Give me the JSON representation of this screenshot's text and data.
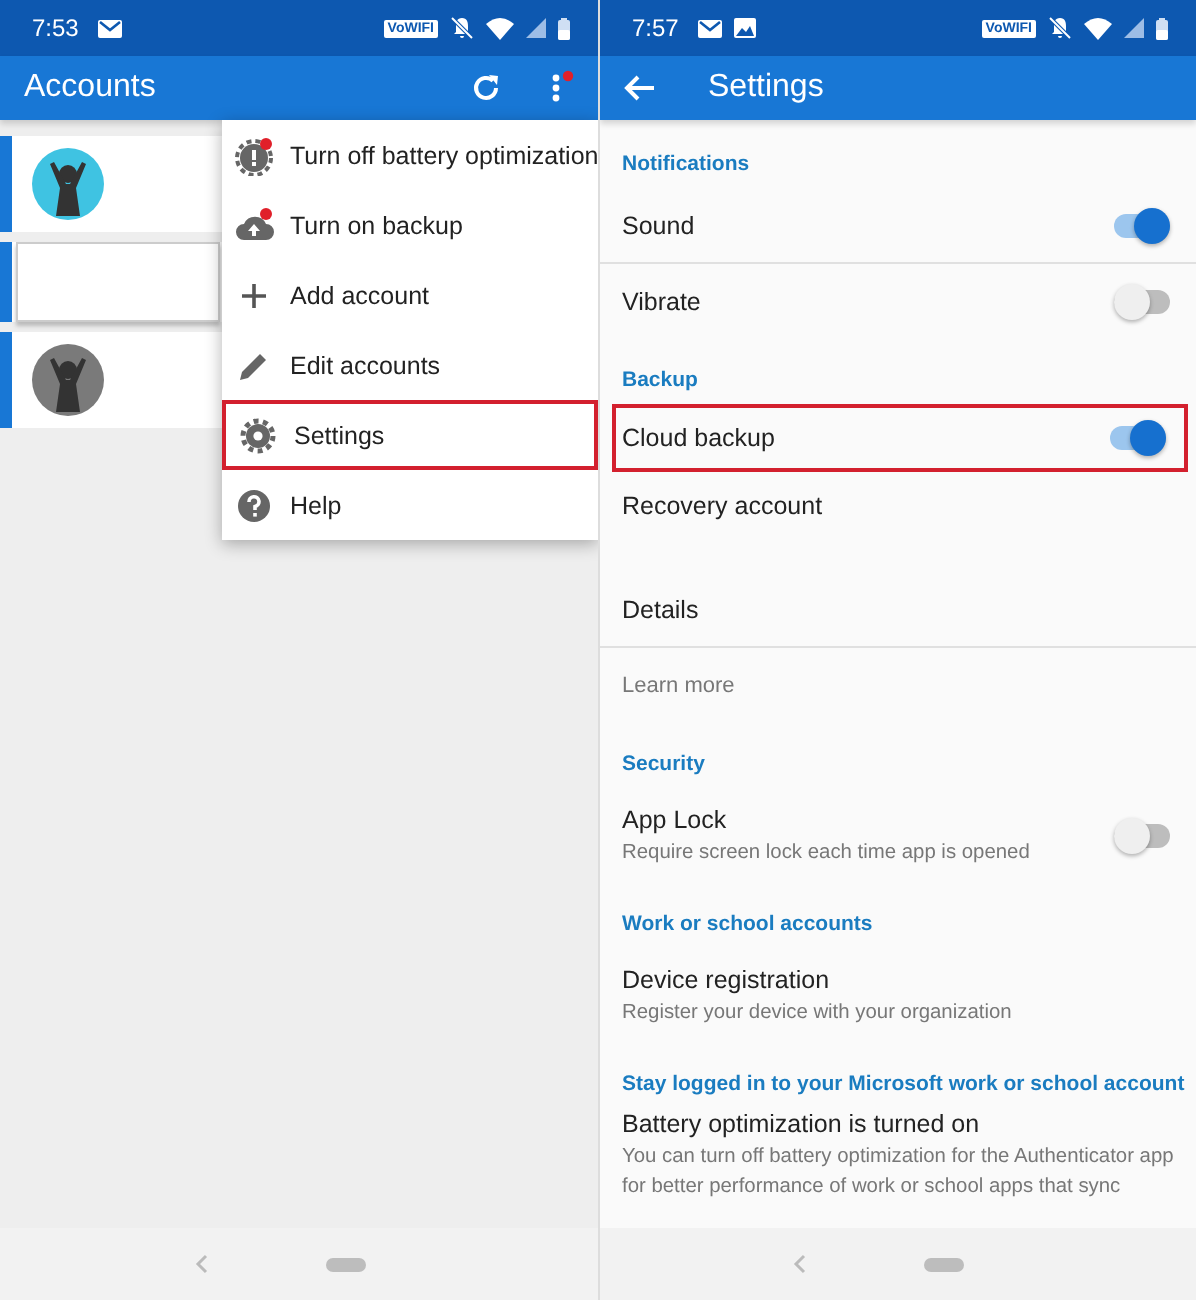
{
  "left_screen": {
    "status_bar": {
      "time": "7:53",
      "network_badge": "VoWIFI"
    },
    "app_bar": {
      "title": "Accounts",
      "more_badge": true
    },
    "accounts": [
      {
        "kind": "avatar",
        "color": "#3fc3e2"
      },
      {
        "kind": "blank"
      },
      {
        "kind": "avatar",
        "color": "#7a7a7a"
      }
    ],
    "menu": [
      {
        "kind": "battery-alert",
        "label": "Turn off battery optimization",
        "badge": true,
        "highlighted": false
      },
      {
        "kind": "cloud-upload",
        "label": "Turn on backup",
        "badge": true,
        "highlighted": false
      },
      {
        "kind": "plus",
        "label": "Add account",
        "badge": false,
        "highlighted": false
      },
      {
        "kind": "pencil",
        "label": "Edit accounts",
        "badge": false,
        "highlighted": false
      },
      {
        "kind": "gear",
        "label": "Settings",
        "badge": false,
        "highlighted": true
      },
      {
        "kind": "help",
        "label": "Help",
        "badge": false,
        "highlighted": false
      }
    ]
  },
  "right_screen": {
    "status_bar": {
      "time": "7:57",
      "network_badge": "VoWIFI"
    },
    "app_bar": {
      "title": "Settings"
    },
    "sections": [
      {
        "title": "Notifications",
        "items": [
          {
            "kind": "toggle",
            "label": "Sound",
            "on": true,
            "highlighted": false,
            "divider_after": true
          },
          {
            "kind": "toggle",
            "label": "Vibrate",
            "on": false,
            "highlighted": false,
            "divider_after": false
          }
        ]
      },
      {
        "title": "Backup",
        "items": [
          {
            "kind": "toggle",
            "label": "Cloud backup",
            "on": true,
            "highlighted": true,
            "divider_after": false
          },
          {
            "kind": "account",
            "label": "Recovery account",
            "highlighted": false,
            "divider_after": false
          },
          {
            "kind": "text",
            "label": "Details",
            "highlighted": false,
            "divider_after": true
          },
          {
            "kind": "link",
            "label": "Learn more",
            "highlighted": false,
            "divider_after": false
          }
        ]
      },
      {
        "title": "Security",
        "items": [
          {
            "kind": "toggle",
            "label": "App Lock",
            "description": "Require screen lock each time app is opened",
            "on": false,
            "highlighted": false,
            "divider_after": false
          }
        ]
      },
      {
        "title": "Work or school accounts",
        "items": [
          {
            "kind": "text",
            "label": "Device registration",
            "description": "Register your device with your organization",
            "highlighted": false,
            "divider_after": false
          }
        ]
      },
      {
        "title": "Stay logged in to your Microsoft work or school account",
        "items": [
          {
            "kind": "text",
            "label": "Battery optimization is turned on",
            "description": "You can turn off battery optimization for the Authenticator app for better performance of work or school apps that sync",
            "highlighted": false,
            "divider_after": false
          }
        ]
      }
    ]
  }
}
